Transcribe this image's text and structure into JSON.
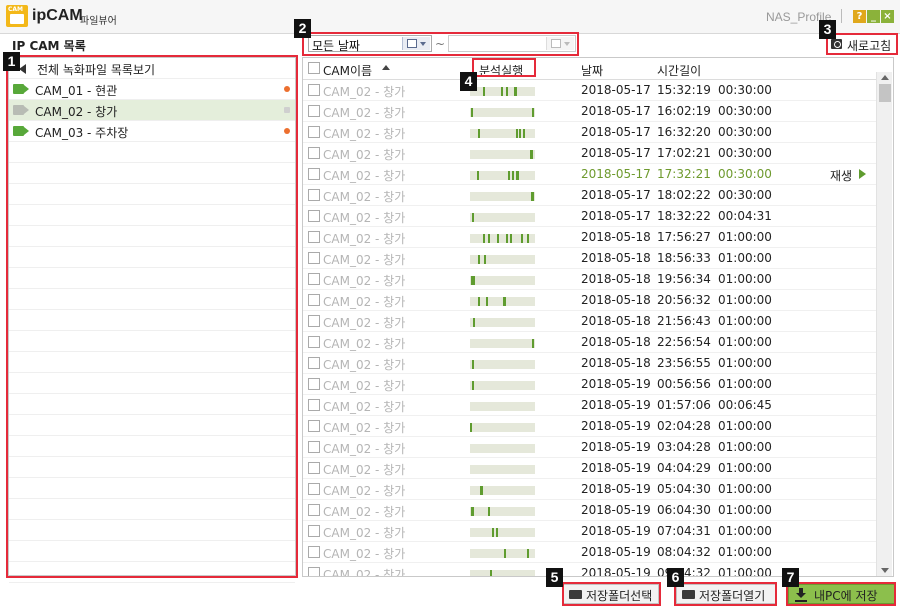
{
  "app": {
    "name": "ipCAM",
    "subtitle": "파일뷰어",
    "user": "NAS_Profile",
    "logo_text": "CAM"
  },
  "window_controls": {
    "help": "?",
    "minimize": "_",
    "close": "×"
  },
  "left_panel": {
    "title": "IP CAM 목록",
    "all_label": "전체 녹화파일 목록보기",
    "cameras": [
      {
        "label": "CAM_01 - 현관",
        "recording": true
      },
      {
        "label": "CAM_02 - 창가",
        "recording": false,
        "selected": true
      },
      {
        "label": "CAM_03 - 주차장",
        "recording": true
      }
    ]
  },
  "filter": {
    "start_date": "모든 날짜",
    "separator": "~",
    "end_date": ""
  },
  "refresh_label": "새로고침",
  "table": {
    "headers": {
      "name": "CAM이름",
      "analysis": "분석실행",
      "date": "날짜",
      "duration": "시간길이"
    },
    "play_label": "재생",
    "rows": [
      {
        "name": "CAM_02 - 창가",
        "date": "2018-05-17",
        "time": "15:32:19",
        "duration": "00:30:00",
        "segs": [
          [
            0.2,
            0.03
          ],
          [
            0.48,
            0.03
          ],
          [
            0.56,
            0.02
          ],
          [
            0.68,
            0.04
          ]
        ]
      },
      {
        "name": "CAM_02 - 창가",
        "date": "2018-05-17",
        "time": "16:02:19",
        "duration": "00:30:00",
        "segs": [
          [
            0.02,
            0.03
          ],
          [
            0.95,
            0.03
          ]
        ]
      },
      {
        "name": "CAM_02 - 창가",
        "date": "2018-05-17",
        "time": "16:32:20",
        "duration": "00:30:00",
        "segs": [
          [
            0.12,
            0.02
          ],
          [
            0.7,
            0.03
          ],
          [
            0.76,
            0.02
          ],
          [
            0.82,
            0.03
          ]
        ]
      },
      {
        "name": "CAM_02 - 창가",
        "date": "2018-05-17",
        "time": "17:02:21",
        "duration": "00:30:00",
        "segs": [
          [
            0.92,
            0.04
          ]
        ]
      },
      {
        "name": "CAM_02 - 창가",
        "date": "2018-05-17",
        "time": "17:32:21",
        "duration": "00:30:00",
        "segs": [
          [
            0.1,
            0.02
          ],
          [
            0.58,
            0.03
          ],
          [
            0.64,
            0.02
          ],
          [
            0.7,
            0.04
          ]
        ],
        "highlighted": true
      },
      {
        "name": "CAM_02 - 창가",
        "date": "2018-05-17",
        "time": "18:02:22",
        "duration": "00:30:00",
        "segs": [
          [
            0.94,
            0.04
          ]
        ]
      },
      {
        "name": "CAM_02 - 창가",
        "date": "2018-05-17",
        "time": "18:32:22",
        "duration": "00:04:31",
        "segs": [
          [
            0.03,
            0.03
          ]
        ]
      },
      {
        "name": "CAM_02 - 창가",
        "date": "2018-05-18",
        "time": "17:56:27",
        "duration": "01:00:00",
        "segs": [
          [
            0.2,
            0.03
          ],
          [
            0.28,
            0.03
          ],
          [
            0.42,
            0.02
          ],
          [
            0.56,
            0.03
          ],
          [
            0.62,
            0.02
          ],
          [
            0.78,
            0.03
          ],
          [
            0.88,
            0.03
          ]
        ]
      },
      {
        "name": "CAM_02 - 창가",
        "date": "2018-05-18",
        "time": "18:56:33",
        "duration": "01:00:00",
        "segs": [
          [
            0.12,
            0.02
          ],
          [
            0.22,
            0.03
          ]
        ]
      },
      {
        "name": "CAM_02 - 창가",
        "date": "2018-05-18",
        "time": "19:56:34",
        "duration": "01:00:00",
        "segs": [
          [
            0.01,
            0.02
          ],
          [
            0.05,
            0.03
          ]
        ]
      },
      {
        "name": "CAM_02 - 창가",
        "date": "2018-05-18",
        "time": "20:56:32",
        "duration": "01:00:00",
        "segs": [
          [
            0.13,
            0.02
          ],
          [
            0.24,
            0.02
          ],
          [
            0.5,
            0.04
          ]
        ]
      },
      {
        "name": "CAM_02 - 창가",
        "date": "2018-05-18",
        "time": "21:56:43",
        "duration": "01:00:00",
        "segs": [
          [
            0.04,
            0.03
          ]
        ]
      },
      {
        "name": "CAM_02 - 창가",
        "date": "2018-05-18",
        "time": "22:56:54",
        "duration": "01:00:00",
        "segs": [
          [
            0.95,
            0.03
          ]
        ]
      },
      {
        "name": "CAM_02 - 창가",
        "date": "2018-05-18",
        "time": "23:56:55",
        "duration": "01:00:00",
        "segs": [
          [
            0.03,
            0.03
          ]
        ]
      },
      {
        "name": "CAM_02 - 창가",
        "date": "2018-05-19",
        "time": "00:56:56",
        "duration": "01:00:00",
        "segs": [
          [
            0.03,
            0.03
          ]
        ]
      },
      {
        "name": "CAM_02 - 창가",
        "date": "2018-05-19",
        "time": "01:57:06",
        "duration": "00:06:45",
        "segs": []
      },
      {
        "name": "CAM_02 - 창가",
        "date": "2018-05-19",
        "time": "02:04:28",
        "duration": "01:00:00",
        "segs": [
          [
            0.0,
            0.02
          ]
        ]
      },
      {
        "name": "CAM_02 - 창가",
        "date": "2018-05-19",
        "time": "03:04:28",
        "duration": "01:00:00",
        "segs": []
      },
      {
        "name": "CAM_02 - 창가",
        "date": "2018-05-19",
        "time": "04:04:29",
        "duration": "01:00:00",
        "segs": []
      },
      {
        "name": "CAM_02 - 창가",
        "date": "2018-05-19",
        "time": "05:04:30",
        "duration": "01:00:00",
        "segs": [
          [
            0.16,
            0.04
          ]
        ]
      },
      {
        "name": "CAM_02 - 창가",
        "date": "2018-05-19",
        "time": "06:04:30",
        "duration": "01:00:00",
        "segs": [
          [
            0.02,
            0.04
          ],
          [
            0.28,
            0.02
          ]
        ]
      },
      {
        "name": "CAM_02 - 창가",
        "date": "2018-05-19",
        "time": "07:04:31",
        "duration": "01:00:00",
        "segs": [
          [
            0.34,
            0.03
          ],
          [
            0.4,
            0.02
          ]
        ]
      },
      {
        "name": "CAM_02 - 창가",
        "date": "2018-05-19",
        "time": "08:04:32",
        "duration": "01:00:00",
        "segs": [
          [
            0.52,
            0.03
          ],
          [
            0.88,
            0.03
          ]
        ]
      },
      {
        "name": "CAM_02 - 창가",
        "date": "2018-05-19",
        "time": "09:04:32",
        "duration": "01:00:00",
        "segs": [
          [
            0.3,
            0.03
          ]
        ]
      }
    ]
  },
  "buttons": {
    "save_folder": "저장폴더선택",
    "open_folder": "저장폴더열기",
    "save_pc": "내PC에 저장"
  },
  "callouts": [
    "1",
    "2",
    "3",
    "4",
    "5",
    "6",
    "7"
  ],
  "colors": {
    "accent": "#8cbf4c",
    "callout": "#e52a3a",
    "segment": "#5f9c2f",
    "recording": "#ec6f2f"
  }
}
